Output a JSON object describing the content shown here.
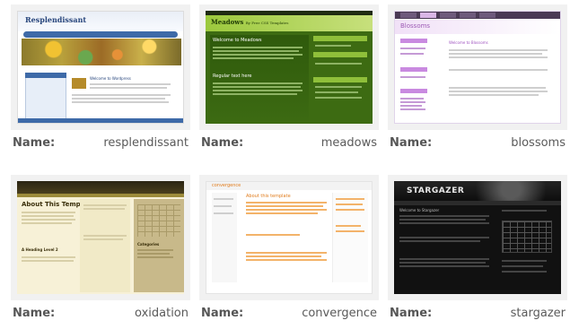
{
  "name_label": "Name:",
  "templates": [
    {
      "name": "resplendissant",
      "thumb": {
        "title": "Resplendissant",
        "post_title": "Welcome to Wordpress"
      }
    },
    {
      "name": "meadows",
      "thumb": {
        "title": "Meadows",
        "subtitle": "By Free CSS Templates",
        "post_title": "Welcome to Meadows",
        "post_title_2": "Regular text here"
      }
    },
    {
      "name": "blossoms",
      "thumb": {
        "title": "Blossoms",
        "post_title": "Welcome to Blossoms"
      }
    },
    {
      "name": "oxidation",
      "thumb": {
        "title": "About This Template",
        "sub_1": "A Heading Level 2",
        "sub_2": "Categories"
      }
    },
    {
      "name": "convergence",
      "thumb": {
        "logo": "convergence",
        "post_title": "About this template"
      }
    },
    {
      "name": "stargazer",
      "thumb": {
        "logo": "STARGAZER",
        "post_title": "Welcome to Stargazer"
      }
    }
  ]
}
